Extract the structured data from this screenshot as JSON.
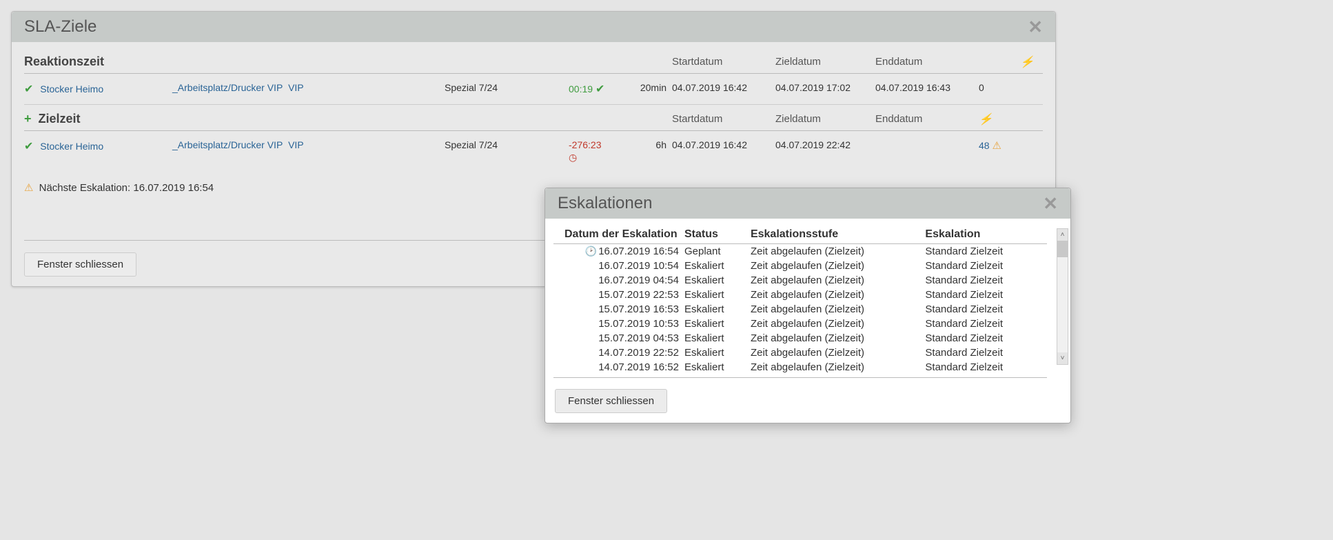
{
  "main": {
    "title": "SLA-Ziele",
    "close_btn": "Fenster schliessen",
    "reaction": {
      "heading": "Reaktionszeit",
      "cols": {
        "start": "Startdatum",
        "target": "Zieldatum",
        "end": "Enddatum"
      },
      "row": {
        "person": "Stocker Heimo",
        "category": "_Arbeitsplatz/Drucker VIP",
        "tag": "VIP",
        "schedule": "Spezial 7/24",
        "elapsed": "00:19",
        "limit": "20min",
        "start": "04.07.2019 16:42",
        "target": "04.07.2019 17:02",
        "end": "04.07.2019 16:43",
        "count": "0"
      }
    },
    "goal": {
      "heading": "Zielzeit",
      "cols": {
        "start": "Startdatum",
        "target": "Zieldatum",
        "end": "Enddatum"
      },
      "row": {
        "person": "Stocker Heimo",
        "category": "_Arbeitsplatz/Drucker VIP",
        "tag": "VIP",
        "schedule": "Spezial 7/24",
        "elapsed": "-276:23",
        "limit": "6h",
        "start": "04.07.2019 16:42",
        "target": "04.07.2019 22:42",
        "end": "",
        "count": "48"
      }
    },
    "next_escalation": "Nächste Eskalation: 16.07.2019 16:54"
  },
  "modal": {
    "title": "Eskalationen",
    "close_btn": "Fenster schliessen",
    "cols": {
      "date": "Datum der Eskalation",
      "status": "Status",
      "level": "Eskalationsstufe",
      "esc": "Eskalation"
    },
    "rows": [
      {
        "clock": true,
        "date": "16.07.2019 16:54",
        "status": "Geplant",
        "level": "Zeit abgelaufen (Zielzeit)",
        "esc": "Standard Zielzeit"
      },
      {
        "clock": false,
        "date": "16.07.2019 10:54",
        "status": "Eskaliert",
        "level": "Zeit abgelaufen (Zielzeit)",
        "esc": "Standard Zielzeit"
      },
      {
        "clock": false,
        "date": "16.07.2019 04:54",
        "status": "Eskaliert",
        "level": "Zeit abgelaufen (Zielzeit)",
        "esc": "Standard Zielzeit"
      },
      {
        "clock": false,
        "date": "15.07.2019 22:53",
        "status": "Eskaliert",
        "level": "Zeit abgelaufen (Zielzeit)",
        "esc": "Standard Zielzeit"
      },
      {
        "clock": false,
        "date": "15.07.2019 16:53",
        "status": "Eskaliert",
        "level": "Zeit abgelaufen (Zielzeit)",
        "esc": "Standard Zielzeit"
      },
      {
        "clock": false,
        "date": "15.07.2019 10:53",
        "status": "Eskaliert",
        "level": "Zeit abgelaufen (Zielzeit)",
        "esc": "Standard Zielzeit"
      },
      {
        "clock": false,
        "date": "15.07.2019 04:53",
        "status": "Eskaliert",
        "level": "Zeit abgelaufen (Zielzeit)",
        "esc": "Standard Zielzeit"
      },
      {
        "clock": false,
        "date": "14.07.2019 22:52",
        "status": "Eskaliert",
        "level": "Zeit abgelaufen (Zielzeit)",
        "esc": "Standard Zielzeit"
      },
      {
        "clock": false,
        "date": "14.07.2019 16:52",
        "status": "Eskaliert",
        "level": "Zeit abgelaufen (Zielzeit)",
        "esc": "Standard Zielzeit"
      }
    ]
  }
}
